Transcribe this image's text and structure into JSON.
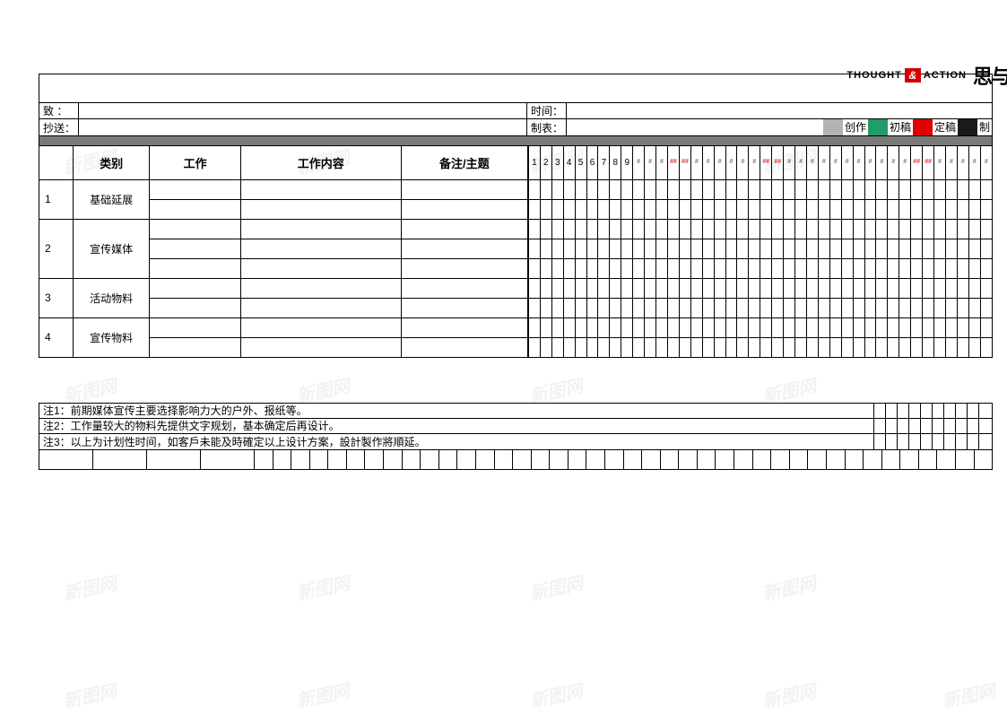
{
  "logo": {
    "en1": "THOUGHT",
    "amp": "&",
    "en2": "ACTION",
    "cn": "思与"
  },
  "header": {
    "to_label": "致 ：",
    "time_label": "时间：",
    "cc_label": "抄送：",
    "form_label": "制表："
  },
  "legend": {
    "create": "创作",
    "draft": "初稿",
    "final": "定稿",
    "make": "制"
  },
  "colors": {
    "create_sw": "#b3b3b3",
    "draft_sw": "#1f9d68",
    "final_sw": "#e00000",
    "make_sw": "#1a1a1a"
  },
  "columns": {
    "category": "类别",
    "work": "工作",
    "content": "工作内容",
    "note": "备注/主题"
  },
  "categories": [
    {
      "idx": "1",
      "name": "基础延展",
      "rows": 2
    },
    {
      "idx": "2",
      "name": "宣传媒体",
      "rows": 3
    },
    {
      "idx": "3",
      "name": "活动物料",
      "rows": 2
    },
    {
      "idx": "4",
      "name": "宣传物料",
      "rows": 2
    }
  ],
  "days_visible": [
    "1",
    "2",
    "3",
    "4",
    "5",
    "6",
    "7",
    "8",
    "9"
  ],
  "gantt_cols": 40,
  "body_rows": 9,
  "notes": [
    "注1：前期媒体宣传主要选择影响力大的户外、报纸等。",
    "注2：工作量较大的物料先提供文字规划，基本确定后再设计。",
    "注3：以上为计划性时间，如客戶未能及時確定以上设计方案，設計製作將順延。"
  ],
  "note_grid_cols": 10,
  "bottom_left_cells": 4,
  "bottom_right_cells": 40,
  "watermark": "新图网"
}
